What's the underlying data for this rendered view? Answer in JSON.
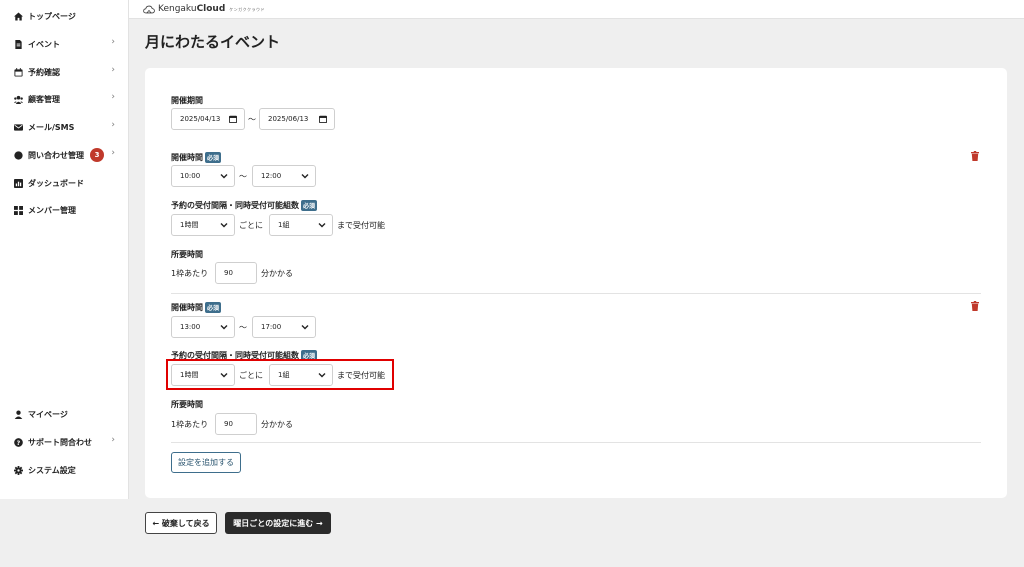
{
  "sidebar": {
    "items": [
      {
        "label": "トップページ",
        "icon": "home-icon",
        "chevron": false
      },
      {
        "label": "イベント",
        "icon": "document-icon",
        "chevron": true
      },
      {
        "label": "予約確認",
        "icon": "calendar-icon",
        "chevron": true
      },
      {
        "label": "顧客管理",
        "icon": "users-icon",
        "chevron": true
      },
      {
        "label": "メール/SMS",
        "icon": "mail-icon",
        "chevron": true
      },
      {
        "label": "問い合わせ管理",
        "icon": "chat-icon",
        "chevron": true,
        "badge": "3"
      },
      {
        "label": "ダッシュボード",
        "icon": "chart-icon",
        "chevron": false
      },
      {
        "label": "メンバー管理",
        "icon": "grid-icon",
        "chevron": false
      }
    ],
    "bottom_items": [
      {
        "label": "マイページ",
        "icon": "user-icon",
        "chevron": false
      },
      {
        "label": "サポート問合わせ",
        "icon": "help-icon",
        "chevron": true
      },
      {
        "label": "システム設定",
        "icon": "gear-icon",
        "chevron": false
      }
    ],
    "chevron_glyph": "›"
  },
  "header": {
    "logo_light": "Kengaku",
    "logo_bold": "Cloud",
    "logo_sub": "ケンガククラウド"
  },
  "page": {
    "title": "月にわたるイベント"
  },
  "form": {
    "period_label": "開催期間",
    "start_date": "2025/04/13",
    "end_date": "2025/06/13",
    "tilde": "〜",
    "required": "必須",
    "time_label": "開催時間",
    "interval_label": "予約の受付間隔・同時受付可能組数",
    "per_text": "ごとに",
    "accept_text": "まで受付可能",
    "duration_label": "所要時間",
    "per_slot_text": "1枠あたり",
    "minutes_text": "分かかる",
    "sessions": [
      {
        "start_time": "10:00",
        "end_time": "12:00",
        "interval": "1時間",
        "groups": "1組",
        "duration": "90"
      },
      {
        "start_time": "13:00",
        "end_time": "17:00",
        "interval": "1時間",
        "groups": "1組",
        "duration": "90"
      }
    ],
    "add_button": "設定を追加する"
  },
  "footer": {
    "back_button": "← 破棄して戻る",
    "next_button": "曜日ごとの設定に進む →"
  },
  "colors": {
    "accent": "#3e6e8c",
    "danger": "#c0392b",
    "highlight": "#e00000"
  }
}
